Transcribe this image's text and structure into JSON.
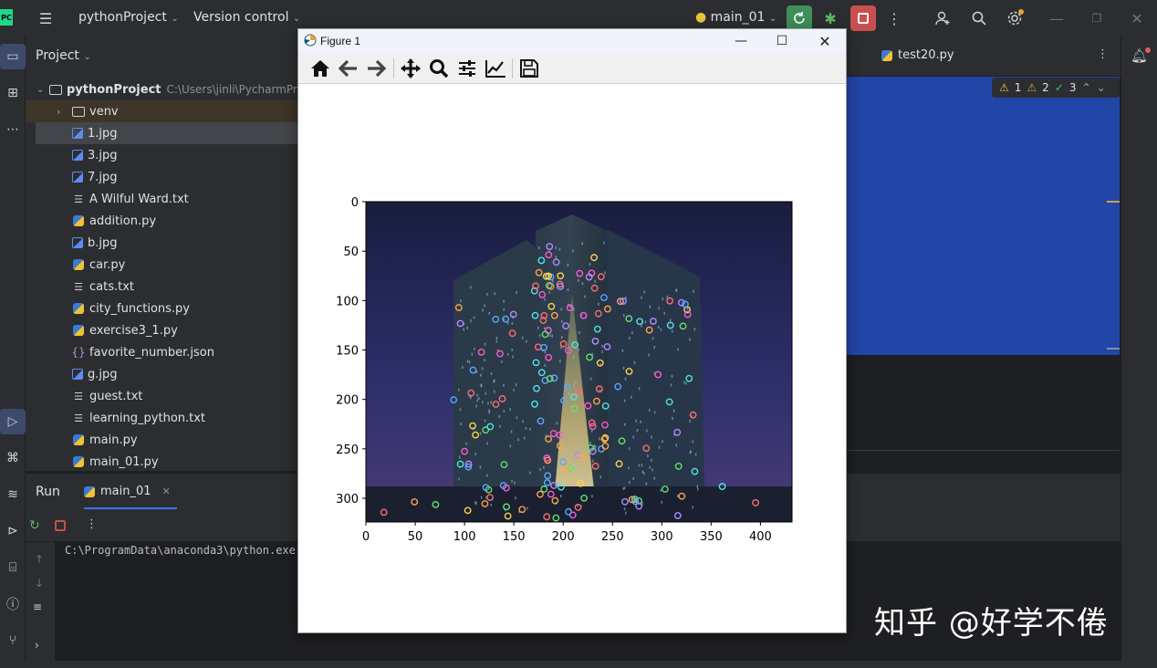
{
  "titlebar": {
    "app_logo": "PC",
    "project_name": "pythonProject",
    "vcs": "Version control",
    "run_config": "main_01"
  },
  "project_panel": {
    "title": "Project",
    "root_name": "pythonProject",
    "root_path": "C:\\Users\\jinli\\PycharmPr",
    "items": [
      {
        "label": "venv",
        "type": "folder"
      },
      {
        "label": "1.jpg",
        "type": "image"
      },
      {
        "label": "3.jpg",
        "type": "image"
      },
      {
        "label": "7.jpg",
        "type": "image"
      },
      {
        "label": "A Wilful Ward.txt",
        "type": "text"
      },
      {
        "label": "addition.py",
        "type": "python"
      },
      {
        "label": "b.jpg",
        "type": "image"
      },
      {
        "label": "car.py",
        "type": "python"
      },
      {
        "label": "cats.txt",
        "type": "text"
      },
      {
        "label": "city_functions.py",
        "type": "python"
      },
      {
        "label": "exercise3_1.py",
        "type": "python"
      },
      {
        "label": "favorite_number.json",
        "type": "json"
      },
      {
        "label": "g.jpg",
        "type": "image"
      },
      {
        "label": "guest.txt",
        "type": "text"
      },
      {
        "label": "learning_python.txt",
        "type": "text"
      },
      {
        "label": "main.py",
        "type": "python"
      },
      {
        "label": "main_01.py",
        "type": "python"
      }
    ]
  },
  "editor": {
    "tab": "test20.py",
    "inspections": {
      "warnings_a": "1",
      "warnings_b": "2",
      "ok": "3"
    }
  },
  "run_panel": {
    "title": "Run",
    "tab": "main_01",
    "console_line": "C:\\ProgramData\\anaconda3\\python.exe C"
  },
  "figure_window": {
    "title": "Figure 1",
    "tools": [
      "home-icon",
      "back-icon",
      "forward-icon",
      "pan-icon",
      "zoom-icon",
      "configure-subplots-icon",
      "edit-axes-icon",
      "save-icon"
    ]
  },
  "chart_data": {
    "type": "image",
    "xticks": [
      "0",
      "50",
      "100",
      "150",
      "200",
      "250",
      "300",
      "350",
      "400"
    ],
    "yticks": [
      "0",
      "50",
      "100",
      "150",
      "200",
      "250",
      "300"
    ],
    "xlim": [
      0,
      432
    ],
    "ylim": [
      324,
      0
    ]
  },
  "watermark": "知乎 @好学不倦"
}
